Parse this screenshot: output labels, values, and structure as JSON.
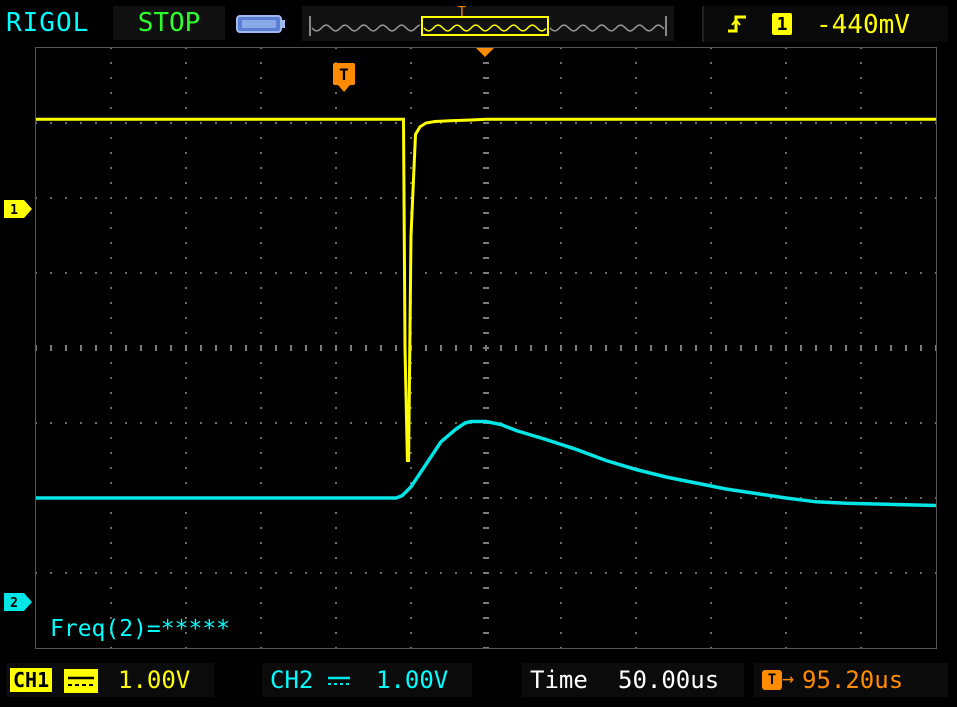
{
  "header": {
    "brand": "RIGOL",
    "run_state": "STOP",
    "trigger": {
      "edge_icon": "rising-edge-icon",
      "source": "1",
      "level": "-440mV"
    },
    "waveform_position_marker": "T"
  },
  "screen": {
    "trigger_marker": "T",
    "channel1_marker": "1",
    "channel2_marker": "2",
    "measurement": "Freq(2)=*****"
  },
  "footer": {
    "ch1": {
      "label": "CH1",
      "coupling": "DC",
      "scale": "1.00V"
    },
    "ch2": {
      "label": "CH2",
      "coupling": "DC",
      "scale": "1.00V"
    },
    "time": {
      "label": "Time",
      "value": "50.00us"
    },
    "delay": {
      "icon": "trigger-delay-icon",
      "value": "95.20us"
    }
  },
  "colors": {
    "ch1": "#ffff00",
    "ch2": "#00e5e5",
    "accent": "#ff8c00",
    "brand": "#00ffff",
    "state": "#2dff2d"
  },
  "chart_data": {
    "type": "line",
    "x_unit": "us",
    "y_unit": "V",
    "x_divisions": 12,
    "y_divisions": 8,
    "series": [
      {
        "name": "CH1",
        "color": "#ffff00",
        "x": [
          -150,
          -30,
          -27.5,
          -27,
          -26.2,
          -25.8,
          -25,
          -24,
          -23.5,
          -22,
          -20,
          -17,
          -12,
          -5,
          0,
          30,
          100,
          150
        ],
        "y": [
          3.05,
          3.05,
          3.05,
          0.0,
          -1.5,
          -1.5,
          1.5,
          2.4,
          2.85,
          2.95,
          3.0,
          3.02,
          3.03,
          3.04,
          3.05,
          3.05,
          3.05,
          3.05
        ]
      },
      {
        "name": "CH2",
        "color": "#00e5e5",
        "x": [
          -150,
          -30,
          -28,
          -25,
          -20,
          -15,
          -10,
          -7,
          -5,
          0,
          5,
          10,
          20,
          30,
          40,
          50,
          60,
          70,
          80,
          90,
          100,
          110,
          120,
          130,
          140,
          150
        ],
        "y": [
          -2.0,
          -2.0,
          -1.97,
          -1.85,
          -1.55,
          -1.25,
          -1.08,
          -1.0,
          -0.98,
          -0.98,
          -1.02,
          -1.1,
          -1.22,
          -1.35,
          -1.5,
          -1.62,
          -1.72,
          -1.8,
          -1.88,
          -1.94,
          -2.0,
          -2.05,
          -2.07,
          -2.08,
          -2.09,
          -2.1
        ]
      }
    ],
    "ylim": [
      -4,
      4
    ],
    "xlim": [
      -150,
      150
    ]
  }
}
